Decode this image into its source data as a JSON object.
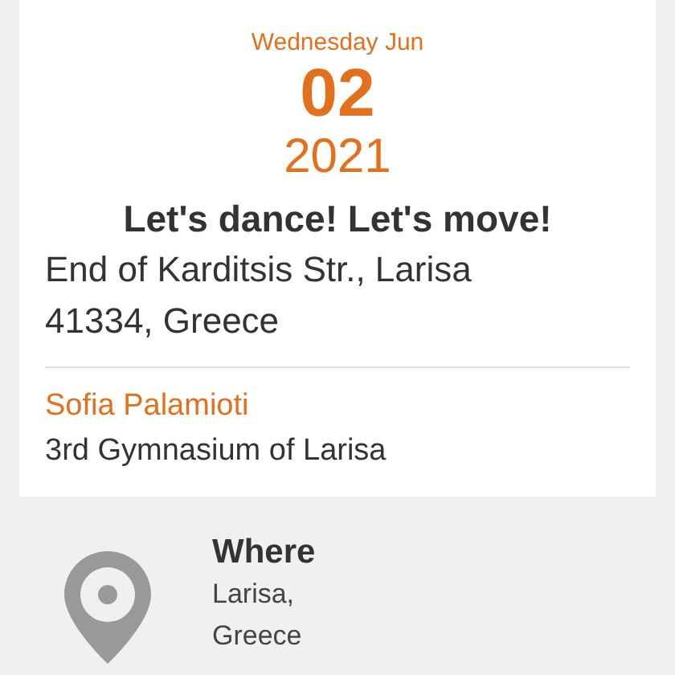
{
  "event": {
    "weekday_month": "Wednesday Jun",
    "day": "02",
    "year": "2021",
    "title": "Let's dance! Let's move!",
    "address": [
      "End of Karditsis Str., Larisa",
      "41334, Greece"
    ],
    "organizer": "Sofia Palamioti",
    "venue": "3rd Gymnasium of Larisa"
  },
  "where": {
    "heading": "Where",
    "lines": [
      "Larisa,",
      "Greece"
    ]
  }
}
